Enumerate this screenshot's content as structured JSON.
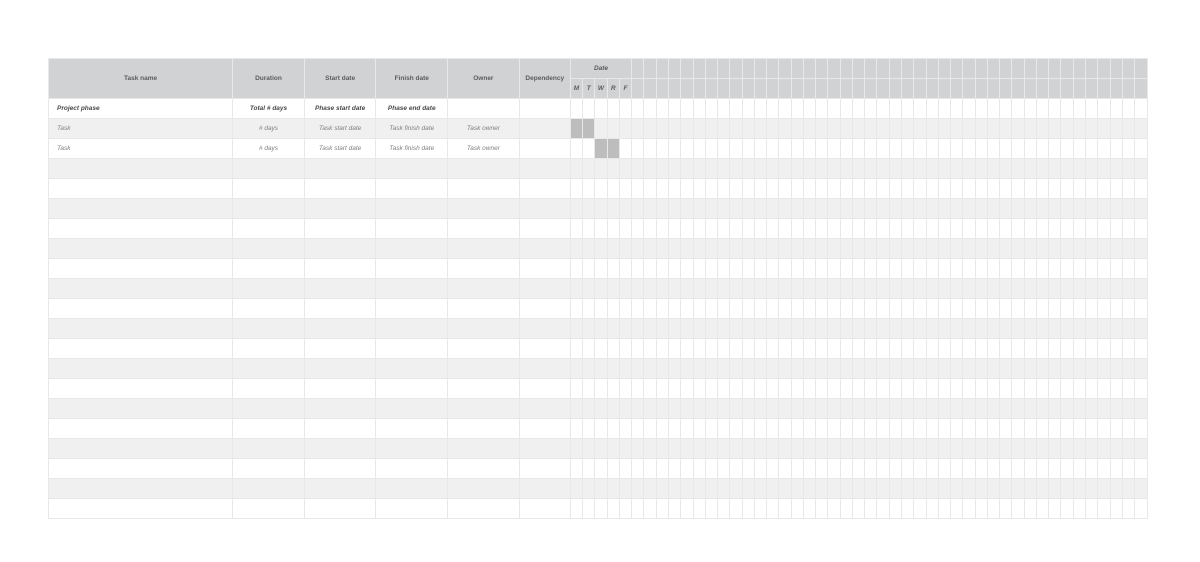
{
  "columns": {
    "task": "Task name",
    "dur": "Duration",
    "start": "Start date",
    "finish": "Finish date",
    "owner": "Owner",
    "dep": "Dependency",
    "date": "Date"
  },
  "week_days": [
    "M",
    "T",
    "W",
    "R",
    "F"
  ],
  "num_day_cols": 47,
  "rows": [
    {
      "type": "phase",
      "task": "Project phase",
      "dur": "Total # days",
      "start": "Phase start date",
      "finish": "Phase end date",
      "owner": "",
      "dep": "",
      "bar_start": -1,
      "bar_len": 0
    },
    {
      "type": "task",
      "task": "Task",
      "dur": "# days",
      "start": "Task start date",
      "finish": "Task finish date",
      "owner": "Task owner",
      "dep": "",
      "bar_start": 0,
      "bar_len": 2
    },
    {
      "type": "task",
      "task": "Task",
      "dur": "# days",
      "start": "Task start date",
      "finish": "Task finish date",
      "owner": "Task owner",
      "dep": "",
      "bar_start": 2,
      "bar_len": 2
    },
    {
      "type": "empty"
    },
    {
      "type": "empty"
    },
    {
      "type": "empty"
    },
    {
      "type": "empty"
    },
    {
      "type": "empty"
    },
    {
      "type": "empty"
    },
    {
      "type": "empty"
    },
    {
      "type": "empty"
    },
    {
      "type": "empty"
    },
    {
      "type": "empty"
    },
    {
      "type": "empty"
    },
    {
      "type": "empty"
    },
    {
      "type": "empty"
    },
    {
      "type": "empty"
    },
    {
      "type": "empty"
    },
    {
      "type": "empty"
    },
    {
      "type": "empty"
    },
    {
      "type": "empty"
    }
  ]
}
